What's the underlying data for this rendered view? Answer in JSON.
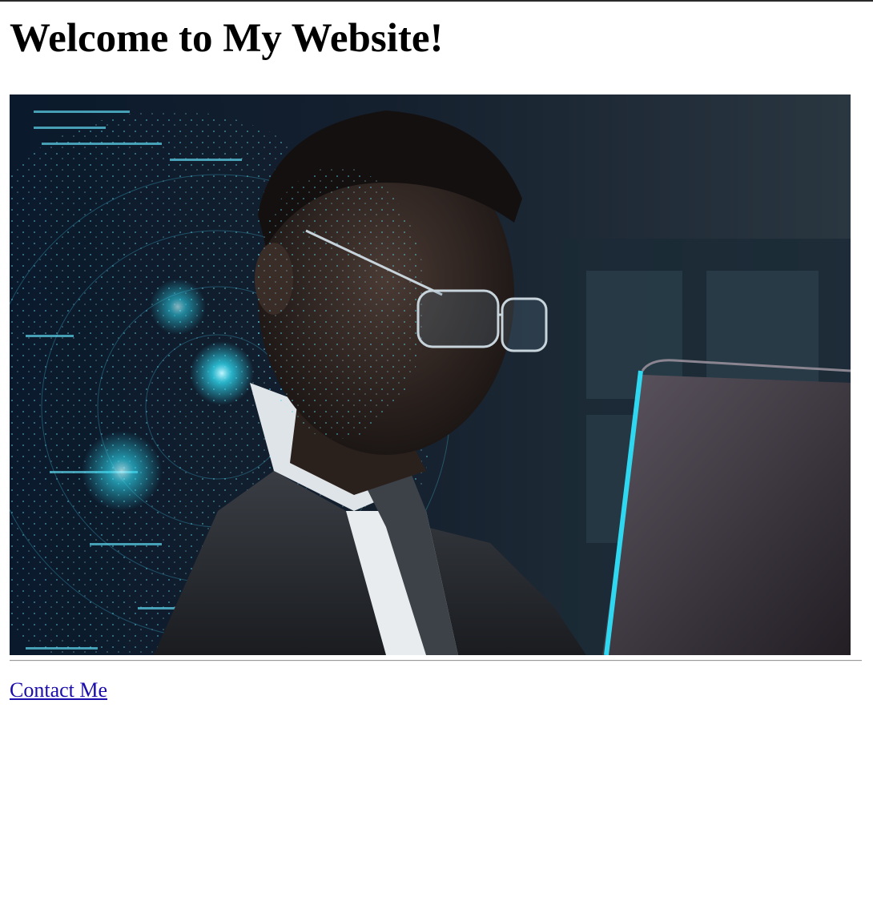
{
  "header": {
    "title": "Welcome to My Website!"
  },
  "hero": {
    "accent_color": "#2fd8f0"
  },
  "footer": {
    "contact_link_label": "Contact Me",
    "link_color": "#1a0dab"
  }
}
